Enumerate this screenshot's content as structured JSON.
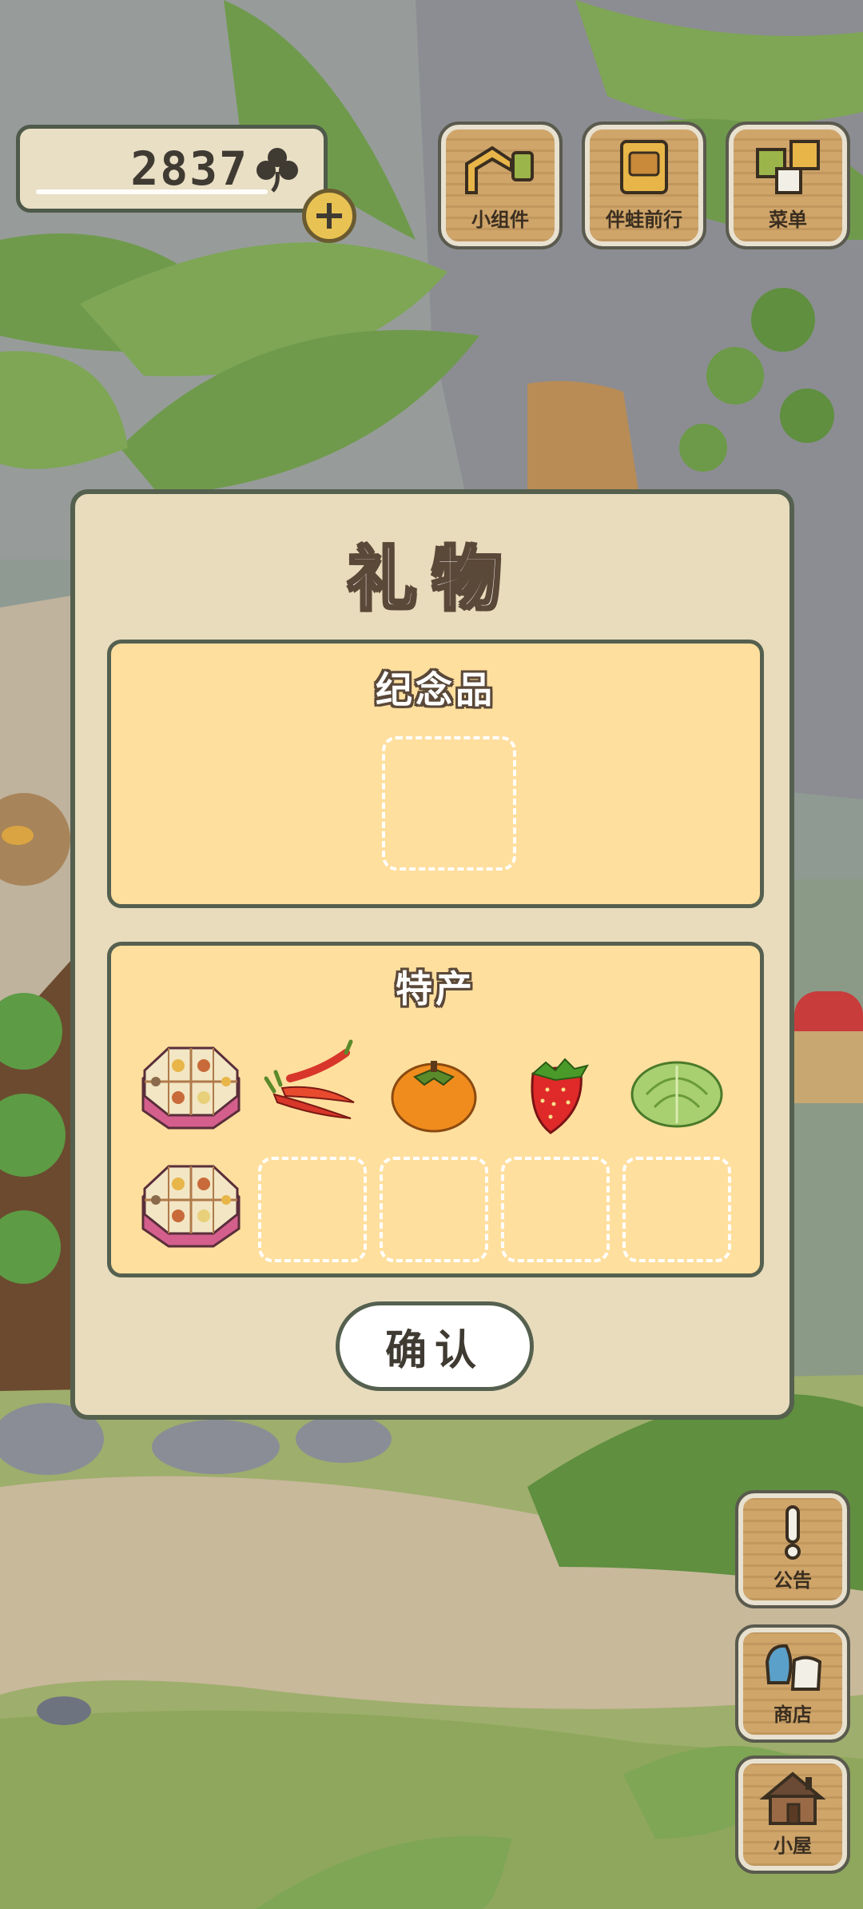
{
  "clover": {
    "count": "2837",
    "icon": "clover-icon"
  },
  "top_menu": [
    {
      "label": "小组件",
      "icon": "widget-icon"
    },
    {
      "label": "伴蛙前行",
      "icon": "album-icon"
    },
    {
      "label": "菜单",
      "icon": "menu-icon"
    }
  ],
  "side_menu": [
    {
      "label": "公告",
      "icon": "exclamation-icon"
    },
    {
      "label": "商店",
      "icon": "bag-icon"
    },
    {
      "label": "小屋",
      "icon": "house-icon"
    }
  ],
  "dialog": {
    "title": "礼物",
    "souvenir": {
      "title": "纪念品"
    },
    "specialty": {
      "title": "特产",
      "items": [
        "bento-box",
        "chili-peppers",
        "persimmon",
        "strawberry",
        "cabbage",
        "bento-box"
      ]
    },
    "confirm_label": "确认"
  },
  "colors": {
    "panel": "#ffdf9e",
    "dialog": "#e8dcbd",
    "border": "#55604f",
    "wood": "#cfa56a"
  }
}
